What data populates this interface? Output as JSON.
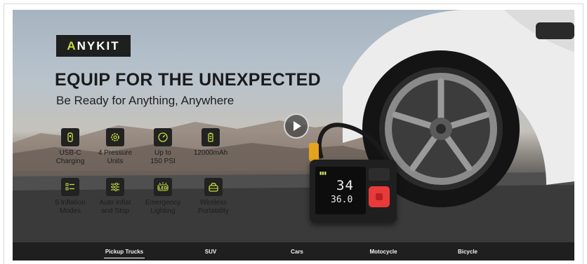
{
  "brand": {
    "logo_prefix": "A",
    "logo_rest": "NYKIT",
    "accent_color": "#c8dc3c"
  },
  "hero": {
    "headline": "EQUIP FOR THE UNEXPECTED",
    "subline": "Be Ready for Anything, Anywhere"
  },
  "features": [
    {
      "label": "USB-C\nCharging",
      "icon": "usb-c-icon"
    },
    {
      "label": "4 Pressure\nUnits",
      "icon": "gear-icon"
    },
    {
      "label": "Up to\n150 PSI",
      "icon": "gauge-icon"
    },
    {
      "label": "12000mAh",
      "icon": "battery-icon"
    },
    {
      "label": "5 Inflation\nModes",
      "icon": "modes-list-icon"
    },
    {
      "label": "Auto Inflat\nand Stop",
      "icon": "sliders-icon"
    },
    {
      "label": "Emergency\nLighting",
      "icon": "led-light-icon"
    },
    {
      "label": "Wireless\nPortability",
      "icon": "carry-bag-icon"
    }
  ],
  "device": {
    "battery_text": "▮▮▮",
    "reading_main": "34",
    "reading_sub": "36.0"
  },
  "nav": {
    "items": [
      "Pickup Trucks",
      "SUV",
      "Cars",
      "Motocycle",
      "Bicycle"
    ],
    "active_index": 0
  }
}
